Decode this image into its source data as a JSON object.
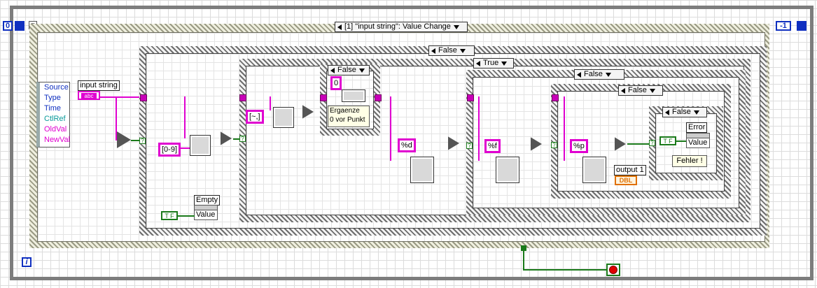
{
  "loop": {
    "iteration_label": "i",
    "shift_left": "0",
    "shift_right": "-1"
  },
  "event": {
    "selector": "[1] \"input string\": Value Change",
    "event_data": [
      "Source",
      "Type",
      "Time",
      "CtlRef",
      "OldVal",
      "NewVal"
    ]
  },
  "controls": {
    "input_string": "input string",
    "string_type": "abc"
  },
  "cases": {
    "case1": "False",
    "case2": "True",
    "case3": "False",
    "case4": "False",
    "case5": "False",
    "case_small": "False"
  },
  "constants": {
    "regex_digits": "[0-9]",
    "regex_sep": "[~,]",
    "zero": "0",
    "fmt_d": "%d",
    "fmt_f": "%f",
    "fmt_p": "%p"
  },
  "notes": {
    "ergaenze": "Ergaenze\n0 vor Punkt",
    "fehler": "Fehler !"
  },
  "indicators": {
    "empty": "Empty",
    "empty_value": "Value",
    "error": "Error",
    "error_value": "Value",
    "output1": "output 1",
    "dbl": "DBL"
  },
  "bool_consts": {
    "tf1": "T F",
    "tf2": "T F"
  },
  "colors": {
    "string_wire": "#e000d0",
    "bool_wire": "#1a7a1a",
    "numeric": "#e07000",
    "frame": "#7d7d7d"
  }
}
